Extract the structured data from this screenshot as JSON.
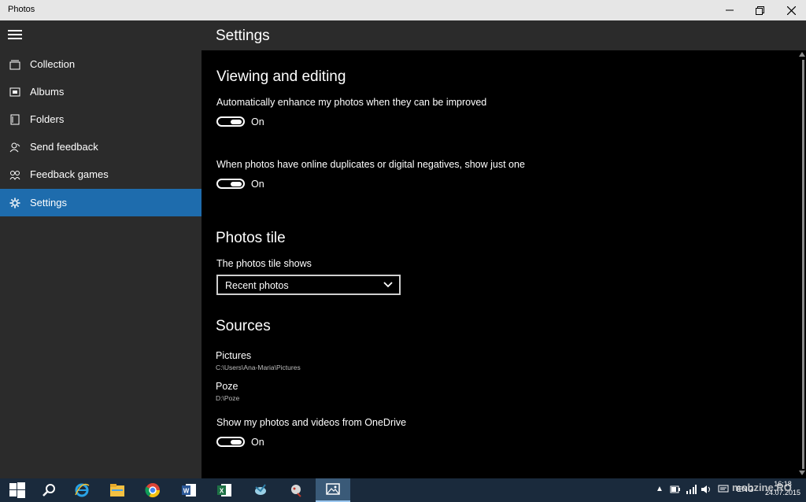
{
  "window": {
    "title": "Photos"
  },
  "sidebar": {
    "items": [
      {
        "label": "Collection",
        "icon": "collection-icon"
      },
      {
        "label": "Albums",
        "icon": "album-icon"
      },
      {
        "label": "Folders",
        "icon": "folder-icon"
      },
      {
        "label": "Send feedback",
        "icon": "feedback-icon"
      },
      {
        "label": "Feedback games",
        "icon": "games-icon"
      },
      {
        "label": "Settings",
        "icon": "gear-icon",
        "active": true
      }
    ],
    "active_color": "#1e6cad"
  },
  "header": {
    "title": "Settings"
  },
  "viewing": {
    "heading": "Viewing and editing",
    "enhance_label": "Automatically enhance my photos when they can be improved",
    "enhance_state": "On",
    "duplicates_label": "When photos have online duplicates or digital negatives, show just one",
    "duplicates_state": "On"
  },
  "tile": {
    "heading": "Photos tile",
    "label": "The photos tile shows",
    "selected": "Recent photos"
  },
  "sources": {
    "heading": "Sources",
    "items": [
      {
        "name": "Pictures",
        "path": "C:\\Users\\Ana-Maria\\Pictures"
      },
      {
        "name": "Poze",
        "path": "D:\\Poze"
      }
    ],
    "onedrive_label": "Show my photos and videos from OneDrive",
    "onedrive_state": "On"
  },
  "taskbar": {
    "clock_time": "16:18",
    "clock_date": "24.07.2015",
    "language": "ENG"
  },
  "watermark": "mobzine.RO"
}
